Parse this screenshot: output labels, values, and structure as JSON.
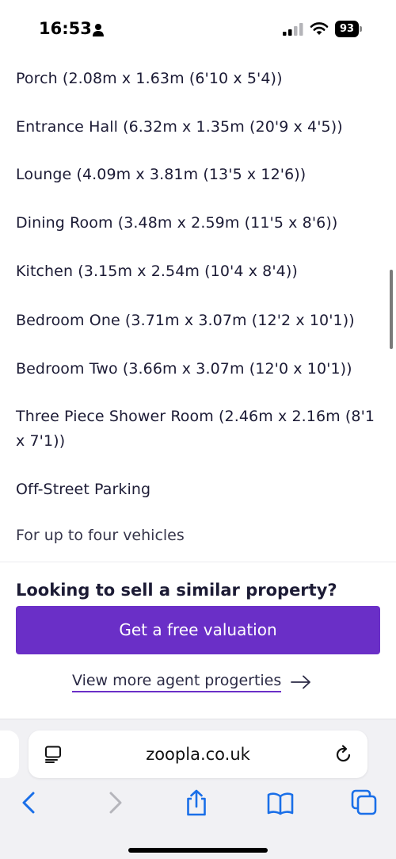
{
  "status_bar": {
    "time": "16:53",
    "battery": "93"
  },
  "features": [
    "Porch (2.08m x 1.63m (6'10 x 5'4))",
    "Entrance Hall (6.32m x 1.35m (20'9 x 4'5))",
    "Lounge (4.09m x 3.81m (13'5 x 12'6))",
    "Dining Room (3.48m x 2.59m (11'5 x 8'6))",
    "Kitchen (3.15m x 2.54m (10'4 x 8'4))",
    "Bedroom One (3.71m x 3.07m (12'2 x 10'1))",
    "Bedroom Two (3.66m x 3.07m (12'0 x 10'1))",
    "Three Piece Shower Room (2.46m x 2.16m (8'1 x 7'1))",
    "Off-Street Parking"
  ],
  "parking_note": "For up to four vehicles",
  "cta": {
    "heading": "Looking to sell a similar property?",
    "button_label": "Get a free valuation",
    "link_label": "View more agent progerties"
  },
  "browser": {
    "url": "zoopla.co.uk"
  },
  "colors": {
    "brand_purple": "#6a2fc7",
    "text_dark": "#1c1b35",
    "toolbar_blue": "#1a6fe8"
  },
  "icons": [
    "person-icon",
    "signal-icon",
    "wifi-icon",
    "reader-icon",
    "reload-icon",
    "back-icon",
    "forward-icon",
    "share-icon",
    "bookmarks-icon",
    "tabs-icon",
    "arrow-right-icon"
  ]
}
